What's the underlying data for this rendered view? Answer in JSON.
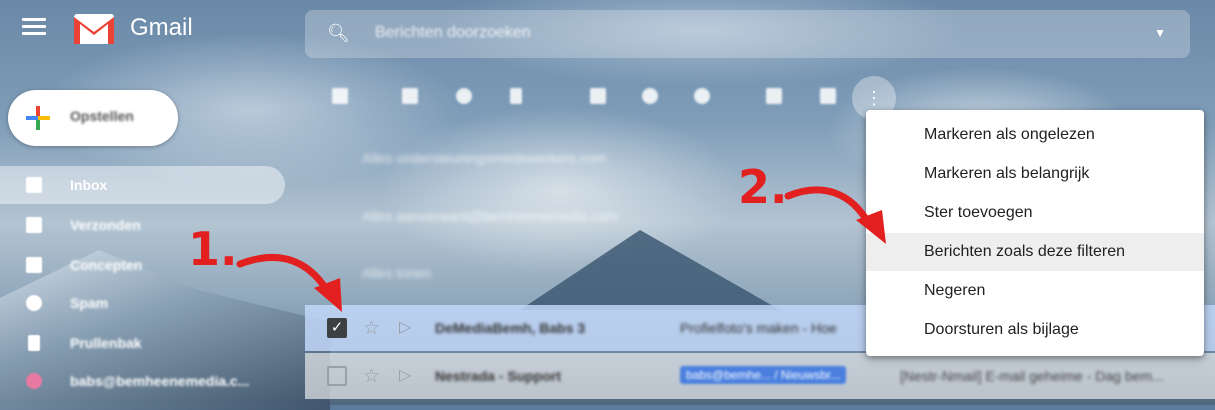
{
  "header": {
    "app_name": "Gmail",
    "search_placeholder": "Berichten doorzoeken"
  },
  "compose": {
    "label": "Opstellen"
  },
  "sidebar": {
    "items": [
      {
        "label": "Inbox",
        "icon": "inbox-icon",
        "active": true
      },
      {
        "label": "Verzonden",
        "icon": "send-icon"
      },
      {
        "label": "Concepten",
        "icon": "draft-icon"
      },
      {
        "label": "Spam",
        "icon": "spam-icon"
      },
      {
        "label": "Prullenbak",
        "icon": "trash-icon"
      },
      {
        "label": "babs@bemheenemedia.c...",
        "icon": "label-icon"
      }
    ]
  },
  "toolbar": {
    "icons": [
      "select-all-icon",
      "archive-icon",
      "report-spam-icon",
      "delete-icon",
      "mark-read-icon",
      "snooze-icon",
      "add-to-tasks-icon",
      "move-to-icon",
      "labels-icon",
      "more-vert-icon"
    ]
  },
  "background_hints": [
    "Alles ondersteuningsmedewerkers.com",
    "Alles aanverwant@bemheenemedia.com",
    "Alles tonen"
  ],
  "annotations": {
    "step1": "1.",
    "step2": "2."
  },
  "emails": [
    {
      "sender": "DeMediaBemh, Babs 3",
      "subject": "Profielfoto's maken - Hoe",
      "selected": true
    },
    {
      "sender": "Nestrada - Support",
      "badge": "babs@bemhe... / Nieuwsbr...",
      "snippet": "[Nestr-Nmail] E-mail geheime - Dag bem...",
      "selected": false
    }
  ],
  "context_menu": {
    "items": [
      {
        "label": "Markeren als ongelezen"
      },
      {
        "label": "Markeren als belangrijk"
      },
      {
        "label": "Ster toevoegen"
      },
      {
        "label": "Berichten zoals deze filteren",
        "highlighted": true
      },
      {
        "label": "Negeren"
      },
      {
        "label": "Doorsturen als bijlage"
      }
    ]
  },
  "colors": {
    "annotation_red": "#e32020",
    "selected_row": "#c2d7f8",
    "gmail_red": "#ea4335"
  }
}
